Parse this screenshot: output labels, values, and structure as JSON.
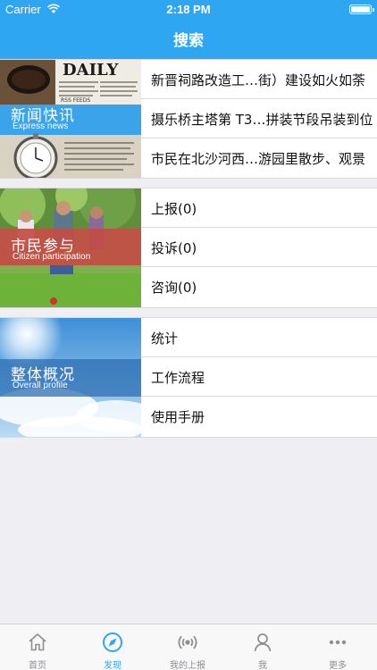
{
  "status_bar": {
    "carrier": "Carrier",
    "time": "2:18 PM"
  },
  "header": {
    "title": "搜索"
  },
  "news": {
    "title": "新闻快讯",
    "subtitle": "Express news",
    "items": [
      "新晋祠路改造工…街）建设如火如荼",
      "摄乐桥主塔第 T3…拼装节段吊装到位",
      "市民在北沙河西…游园里散步、观景"
    ]
  },
  "citizen": {
    "title": "市民参与",
    "subtitle": "Citizen participation",
    "items": [
      "上报(0)",
      "投诉(0)",
      "咨询(0)"
    ]
  },
  "overview": {
    "title": "整体概况",
    "subtitle": "Overall profile",
    "items": [
      "统计",
      "工作流程",
      "使用手册"
    ]
  },
  "tabbar": {
    "items": [
      {
        "label": "首页",
        "icon": "home-icon"
      },
      {
        "label": "发现",
        "icon": "compass-icon",
        "active": true
      },
      {
        "label": "我的上报",
        "icon": "broadcast-icon"
      },
      {
        "label": "我",
        "icon": "person-icon"
      },
      {
        "label": "更多",
        "icon": "more-icon"
      }
    ]
  },
  "colors": {
    "accent": "#2ea6f2",
    "background": "#eeeef3",
    "tab_inactive": "#8e8e93"
  }
}
